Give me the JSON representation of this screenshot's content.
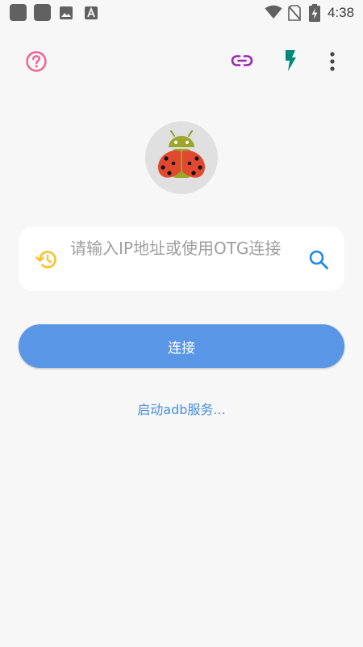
{
  "status_bar": {
    "time": "4:38",
    "icons": [
      "app-notification-icon",
      "app-notification-icon",
      "image-notification-icon",
      "text-notification-icon",
      "wifi-icon",
      "no-sim-icon",
      "battery-charging-icon"
    ]
  },
  "toolbar": {
    "icons": [
      "help-icon",
      "link-icon",
      "flash-icon",
      "more-vert-icon"
    ]
  },
  "avatar": {
    "icon": "ladybug-android-icon"
  },
  "input": {
    "placeholder": "请输入IP地址或使用OTG连接",
    "value": "",
    "left_icon": "history-icon",
    "right_icon": "search-icon"
  },
  "connect": {
    "label": "连接"
  },
  "adb": {
    "label": "启动adb服务..."
  },
  "colors": {
    "background": "#f7f7f7",
    "help": "#f06292",
    "link": "#9c27b0",
    "flash": "#00897b",
    "history": "#fbc02d",
    "search": "#1e88e5",
    "button": "#5a96e6",
    "link_text": "#4a8fdc"
  }
}
